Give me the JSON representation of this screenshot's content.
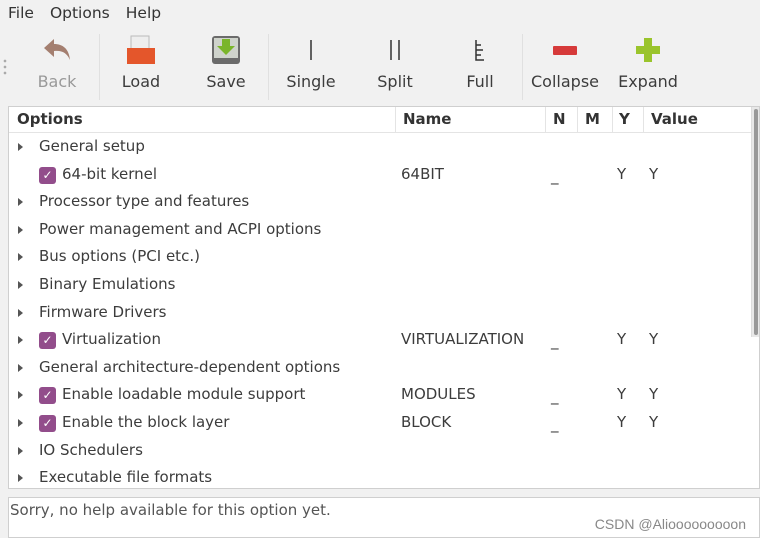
{
  "menu": {
    "file": "File",
    "options": "Options",
    "help": "Help"
  },
  "toolbar": {
    "back": "Back",
    "load": "Load",
    "save": "Save",
    "single": "Single",
    "split": "Split",
    "full": "Full",
    "collapse": "Collapse",
    "expand": "Expand"
  },
  "columns": {
    "options": "Options",
    "name": "Name",
    "n": "N",
    "m": "M",
    "y": "Y",
    "value": "Value"
  },
  "rows": [
    {
      "label": "General setup",
      "expander": true,
      "checkbox": false,
      "name": "",
      "n": "",
      "y": "",
      "value": ""
    },
    {
      "label": "64-bit kernel",
      "expander": false,
      "checkbox": true,
      "name": "64BIT",
      "n": "_",
      "y": "Y",
      "value": "Y"
    },
    {
      "label": "Processor type and features",
      "expander": true,
      "checkbox": false,
      "name": "",
      "n": "",
      "y": "",
      "value": ""
    },
    {
      "label": "Power management and ACPI options",
      "expander": true,
      "checkbox": false,
      "name": "",
      "n": "",
      "y": "",
      "value": ""
    },
    {
      "label": "Bus options (PCI etc.)",
      "expander": true,
      "checkbox": false,
      "name": "",
      "n": "",
      "y": "",
      "value": ""
    },
    {
      "label": "Binary Emulations",
      "expander": true,
      "checkbox": false,
      "name": "",
      "n": "",
      "y": "",
      "value": ""
    },
    {
      "label": "Firmware Drivers",
      "expander": true,
      "checkbox": false,
      "name": "",
      "n": "",
      "y": "",
      "value": ""
    },
    {
      "label": "Virtualization",
      "expander": true,
      "checkbox": true,
      "name": "VIRTUALIZATION",
      "n": "_",
      "y": "Y",
      "value": "Y"
    },
    {
      "label": "General architecture-dependent options",
      "expander": true,
      "checkbox": false,
      "name": "",
      "n": "",
      "y": "",
      "value": ""
    },
    {
      "label": "Enable loadable module support",
      "expander": true,
      "checkbox": true,
      "name": "MODULES",
      "n": "_",
      "y": "Y",
      "value": "Y"
    },
    {
      "label": "Enable the block layer",
      "expander": true,
      "checkbox": true,
      "name": "BLOCK",
      "n": "_",
      "y": "Y",
      "value": "Y"
    },
    {
      "label": "IO Schedulers",
      "expander": true,
      "checkbox": false,
      "name": "",
      "n": "",
      "y": "",
      "value": ""
    },
    {
      "label": "Executable file formats",
      "expander": true,
      "checkbox": false,
      "name": "",
      "n": "",
      "y": "",
      "value": ""
    }
  ],
  "help_text": "Sorry, no help available for this option yet.",
  "watermark": "CSDN @Aliooooooooon",
  "colors": {
    "checkbox": "#924d8b"
  }
}
